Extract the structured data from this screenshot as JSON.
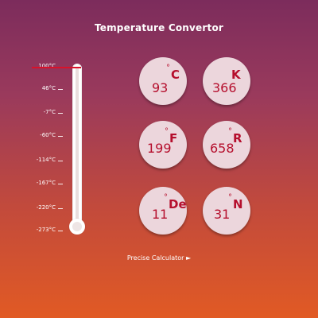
{
  "title": "Temperature Convertor",
  "thermometer": {
    "ticks": [
      "100°C",
      "46°C",
      "-7°C",
      "-60°C",
      "-114°C",
      "-167°C",
      "-220°C",
      "-273°C"
    ],
    "level_celsius": 100,
    "marker_color": "#d9122a"
  },
  "units": [
    {
      "value": "93",
      "degree": "°",
      "symbol": "C"
    },
    {
      "value": "366",
      "degree": "",
      "symbol": "K"
    },
    {
      "value": "199",
      "degree": "°",
      "symbol": "F"
    },
    {
      "value": "658",
      "degree": "°",
      "symbol": "R"
    },
    {
      "value": "11",
      "degree": "°",
      "symbol": "De"
    },
    {
      "value": "31",
      "degree": "°",
      "symbol": "N"
    }
  ],
  "link": {
    "label": "Precise Calculator ►"
  },
  "colors": {
    "accent": "#b50f2d",
    "card_bg": "#ecd6dc"
  }
}
